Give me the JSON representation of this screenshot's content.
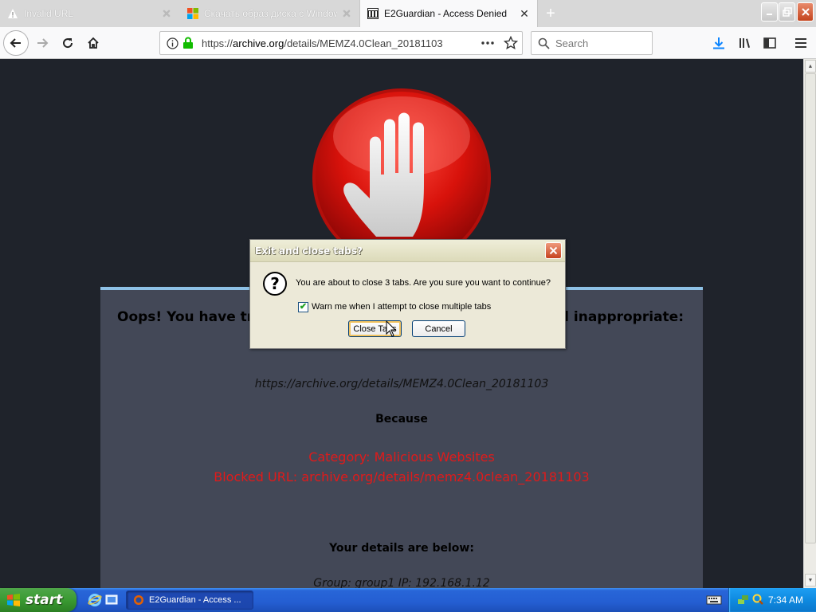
{
  "browser": {
    "tabs": [
      {
        "label": "Invalid URL",
        "icon": "warning-icon",
        "active": false
      },
      {
        "label": "Скачать образ диска с Windows",
        "icon": "microsoft-logo-icon",
        "active": false
      },
      {
        "label": "E2Guardian - Access Denied",
        "icon": "archive-building-icon",
        "active": true
      }
    ],
    "url_prefix": "https://",
    "url_host": "archive.org",
    "url_path": "/details/MEMZ4.0Clean_20181103",
    "search_placeholder": "Search"
  },
  "page": {
    "oops_left": "Oops! You have tri",
    "oops_right": "ed inappropriate:",
    "requested_url": "https://archive.org/details/MEMZ4.0Clean_20181103",
    "because": "Because",
    "category": "Category: Malicious Websites",
    "blocked_url": "Blocked URL: archive.org/details/memz4.0clean_20181103",
    "details_title": "Your details are below:",
    "details_line": "Group: group1   IP: 192.168.1.12",
    "accent_color": "#e11a1a"
  },
  "dialog": {
    "title": "Exit and close tabs?",
    "message": "You are about to close 3 tabs. Are you sure you want to continue?",
    "checkbox_label": "Warn me when I attempt to close multiple tabs",
    "checkbox_checked": true,
    "close_tabs_label": "Close Tabs",
    "cancel_label": "Cancel"
  },
  "taskbar": {
    "start_label": "start",
    "task_item_label": "E2Guardian - Access ...",
    "clock": "7:34 AM"
  }
}
